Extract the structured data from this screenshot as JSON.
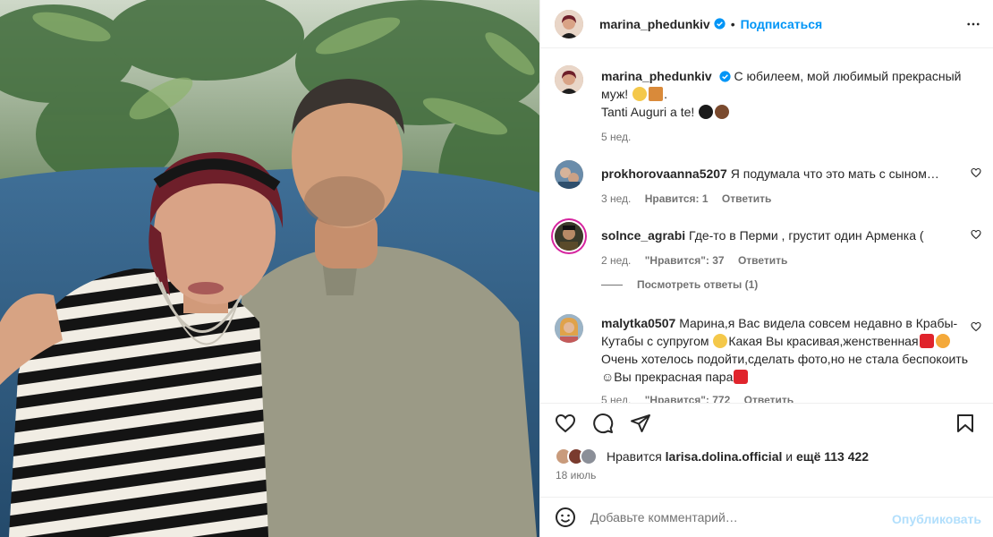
{
  "post": {
    "author": "marina_phedunkiv",
    "dot": "•",
    "follow_label": "Подписаться",
    "caption_line1": "С юбилеем, мой любимый прекрасный муж!",
    "caption_line2": "Tanti Auguri a te!",
    "caption_time": "5 нед."
  },
  "comments": [
    {
      "username": "prokhorovaanna5207",
      "text": "Я подумала что это мать с сыном…",
      "time": "3 нед.",
      "likes": "Нравится: 1",
      "reply": "Ответить"
    },
    {
      "username": "solnce_agrabi",
      "text": "Где-то в Перми , грустит один Арменка (",
      "time": "2 нед.",
      "likes": "\"Нравится\": 37",
      "reply": "Ответить",
      "view_replies": "Посмотреть ответы (1)"
    },
    {
      "username": "malytka0507",
      "text_a": "Марина,я Вас видела совсем недавно в Крабы-Кутабы с супругом",
      "text_b": "Какая Вы красивая,женственная",
      "text_c": "Очень хотелось подойти,сделать фото,но не стала беспокоить☺Вы прекрасная пара",
      "time": "5 нед.",
      "likes": "\"Нравится\": 772",
      "reply": "Ответить"
    }
  ],
  "likes": {
    "prefix": "Нравится",
    "user": "larisa.dolina.official",
    "and": "и",
    "others": "ещё 113 422"
  },
  "date": "18 июль",
  "composer": {
    "placeholder": "Добавьте комментарий…",
    "publish_label": "Опубликовать"
  },
  "colors": {
    "accent": "#0095f6",
    "publish_disabled": "#b2dffc",
    "secondary_text": "#737373",
    "verified": "#0095f6"
  },
  "icons": [
    "more-icon",
    "verified-icon",
    "heart-icon",
    "comment-icon",
    "share-icon",
    "bookmark-icon",
    "emoji-icon"
  ]
}
